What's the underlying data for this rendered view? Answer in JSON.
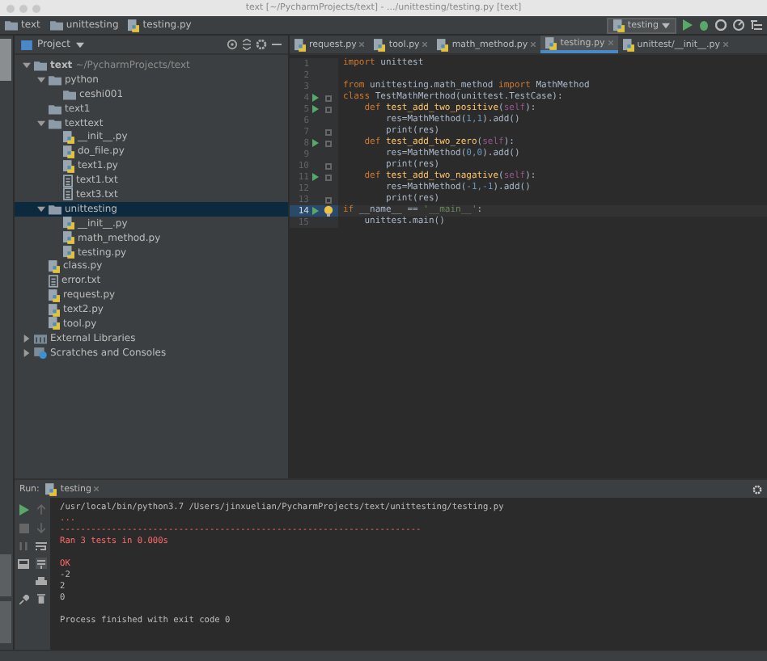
{
  "window": {
    "title": "text [~/PycharmProjects/text] - .../unittesting/testing.py [text]"
  },
  "breadcrumbs": [
    {
      "label": "text",
      "kind": "folder"
    },
    {
      "label": "unittesting",
      "kind": "folder"
    },
    {
      "label": "testing.py",
      "kind": "py"
    }
  ],
  "toolbar": {
    "run_config": "testing"
  },
  "tool_windows": [
    {
      "selected": true
    },
    {
      "selected": false
    },
    {
      "selected": false
    }
  ],
  "project": {
    "title": "Project",
    "tree": [
      {
        "label": "text",
        "hint": "~/PycharmProjects/text",
        "kind": "folder",
        "expanded": true,
        "selected": false,
        "children": [
          {
            "label": "python",
            "kind": "folder",
            "expanded": true,
            "selected": false,
            "children": [
              {
                "label": "ceshi001",
                "kind": "folder",
                "selected": false
              }
            ]
          },
          {
            "label": "text1",
            "kind": "folder",
            "selected": false
          },
          {
            "label": "texttext",
            "kind": "folder",
            "expanded": true,
            "selected": false,
            "children": [
              {
                "label": "__init__.py",
                "kind": "py",
                "selected": false
              },
              {
                "label": "do_file.py",
                "kind": "py",
                "selected": false
              },
              {
                "label": "text1.py",
                "kind": "py",
                "selected": false
              },
              {
                "label": "text1.txt",
                "kind": "txt",
                "selected": false
              },
              {
                "label": "text3.txt",
                "kind": "txt",
                "selected": false
              }
            ]
          },
          {
            "label": "unittesting",
            "kind": "folder",
            "expanded": true,
            "selected": true,
            "children": [
              {
                "label": "__init__.py",
                "kind": "py",
                "selected": false
              },
              {
                "label": "math_method.py",
                "kind": "py",
                "selected": false
              },
              {
                "label": "testing.py",
                "kind": "py",
                "selected": false
              }
            ]
          },
          {
            "label": "class.py",
            "kind": "py",
            "selected": false
          },
          {
            "label": "error.txt",
            "kind": "txt",
            "selected": false
          },
          {
            "label": "request.py",
            "kind": "py",
            "selected": false
          },
          {
            "label": "text2.py",
            "kind": "py",
            "selected": false
          },
          {
            "label": "tool.py",
            "kind": "py",
            "selected": false
          }
        ]
      },
      {
        "label": "External Libraries",
        "kind": "lib",
        "expanded": false,
        "selected": false
      },
      {
        "label": "Scratches and Consoles",
        "kind": "scratch",
        "expanded": false,
        "selected": false
      }
    ]
  },
  "editor": {
    "tabs": [
      {
        "label": "request.py",
        "selected": false
      },
      {
        "label": "tool.py",
        "selected": false
      },
      {
        "label": "math_method.py",
        "selected": false
      },
      {
        "label": "testing.py",
        "selected": true
      },
      {
        "label": "unittest/__init__.py",
        "selected": false
      }
    ],
    "lines": [
      {
        "n": "1",
        "tokens": [
          {
            "t": "import",
            "kind": "kw"
          },
          {
            "t": " unittest",
            "kind": "plain"
          }
        ]
      },
      {
        "n": "2"
      },
      {
        "n": "3",
        "tokens": [
          {
            "t": "from",
            "kind": "kw"
          },
          {
            "t": " unittesting.math_method ",
            "kind": "plain"
          },
          {
            "t": "import",
            "kind": "kw"
          },
          {
            "t": " MathMethod",
            "kind": "plain"
          }
        ]
      },
      {
        "n": "4",
        "run": true,
        "fold": true,
        "tokens": [
          {
            "t": "class",
            "kind": "kw"
          },
          {
            "t": " TestMathMerthod(unittest.TestCase):",
            "kind": "plain"
          }
        ]
      },
      {
        "n": "5",
        "run": true,
        "fold": true,
        "tokens": [
          {
            "t": "    def",
            "kind": "kw"
          },
          {
            "t": " test_add_two_positive",
            "kind": "fn"
          },
          {
            "t": "(",
            "kind": "plain"
          },
          {
            "t": "self",
            "kind": "self"
          },
          {
            "t": "):",
            "kind": "plain"
          }
        ]
      },
      {
        "n": "6",
        "tokens": [
          {
            "t": "        res=MathMethod(",
            "kind": "plain"
          },
          {
            "t": "1,",
            "kind": "num"
          },
          {
            "t": "1",
            "kind": "num"
          },
          {
            "t": ").add()",
            "kind": "plain"
          }
        ]
      },
      {
        "n": "7",
        "fold": true,
        "tokens": [
          {
            "t": "        print(res)",
            "kind": "plain"
          }
        ]
      },
      {
        "n": "8",
        "run": true,
        "fold": true,
        "tokens": [
          {
            "t": "    def",
            "kind": "kw"
          },
          {
            "t": " test_add_two_zero",
            "kind": "fn"
          },
          {
            "t": "(",
            "kind": "plain"
          },
          {
            "t": "self",
            "kind": "self"
          },
          {
            "t": "):",
            "kind": "plain"
          }
        ]
      },
      {
        "n": "9",
        "tokens": [
          {
            "t": "        res=MathMethod(",
            "kind": "plain"
          },
          {
            "t": "0,",
            "kind": "num"
          },
          {
            "t": "0",
            "kind": "num"
          },
          {
            "t": ").add()",
            "kind": "plain"
          }
        ]
      },
      {
        "n": "10",
        "fold": true,
        "tokens": [
          {
            "t": "        print(res)",
            "kind": "plain"
          }
        ]
      },
      {
        "n": "11",
        "run": true,
        "fold": true,
        "tokens": [
          {
            "t": "    def",
            "kind": "kw"
          },
          {
            "t": " test_add_two_nagative",
            "kind": "fn"
          },
          {
            "t": "(",
            "kind": "plain"
          },
          {
            "t": "self",
            "kind": "self"
          },
          {
            "t": "):",
            "kind": "plain"
          }
        ]
      },
      {
        "n": "12",
        "tokens": [
          {
            "t": "        res=MathMethod(",
            "kind": "plain"
          },
          {
            "t": "-1,",
            "kind": "num"
          },
          {
            "t": "-1",
            "kind": "num"
          },
          {
            "t": ").add()",
            "kind": "plain"
          }
        ]
      },
      {
        "n": "13",
        "fold": true,
        "tokens": [
          {
            "t": "        print(res)",
            "kind": "plain"
          }
        ]
      },
      {
        "n": "14",
        "run": true,
        "current": true,
        "bulb": true,
        "tokens": [
          {
            "t": "if",
            "kind": "kw"
          },
          {
            "t": " __name__ == ",
            "kind": "plain"
          },
          {
            "t": "'__main__'",
            "kind": "str"
          },
          {
            "t": ":",
            "kind": "plain"
          }
        ]
      },
      {
        "n": "15",
        "tokens": [
          {
            "t": "    unittest.main()",
            "kind": "plain"
          }
        ]
      }
    ]
  },
  "run": {
    "label": "Run:",
    "tab": "testing",
    "console": [
      {
        "lines": [
          {
            "text": "/usr/local/bin/python3.7 /Users/jinxuelian/PycharmProjects/text/unittesting/testing.py",
            "kind": "plain"
          },
          {
            "text": "...",
            "kind": "err"
          },
          {
            "text": "----------------------------------------------------------------------",
            "kind": "err"
          },
          {
            "text": "Ran 3 tests in 0.000s",
            "kind": "err"
          }
        ]
      },
      {
        "lines": [
          {
            "text": "OK",
            "kind": "err"
          },
          {
            "text": "-2",
            "kind": "plain"
          },
          {
            "text": "2",
            "kind": "plain"
          },
          {
            "text": "0",
            "kind": "plain"
          }
        ]
      },
      {
        "lines": [
          {
            "text": "Process finished with exit code 0",
            "kind": "plain"
          }
        ]
      }
    ]
  }
}
